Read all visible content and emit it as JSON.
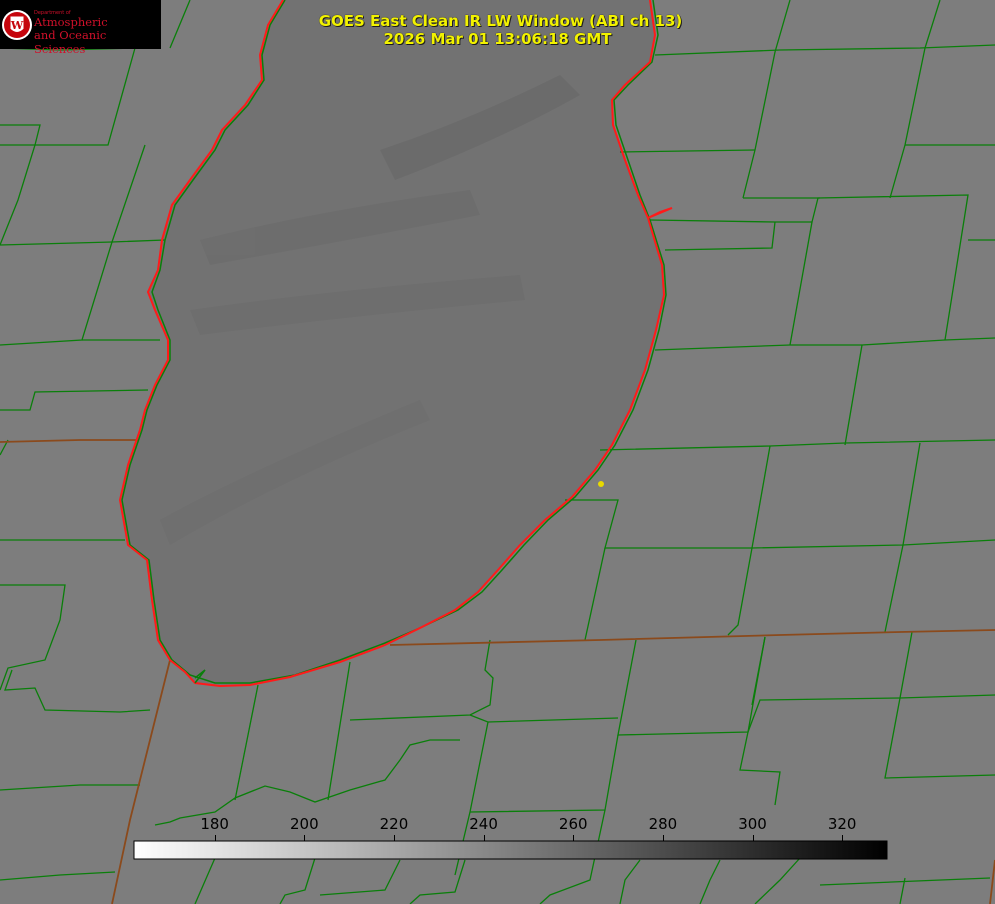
{
  "logo": {
    "department": "Department of",
    "line1": "Atmospheric",
    "line2": "and Oceanic Sciences",
    "seal_letter": "W"
  },
  "title": {
    "line1": "GOES East Clean IR LW Window (ABI ch 13)",
    "line2": "2026 Mar 01 13:06:18 GMT"
  },
  "colorbar": {
    "ticks": [
      "180",
      "200",
      "220",
      "240",
      "260",
      "280",
      "300",
      "320"
    ],
    "tick_values": [
      180,
      200,
      220,
      240,
      260,
      280,
      300,
      320
    ],
    "range": [
      162,
      330
    ],
    "colormap": "white-to-black (brightness temperature, K)"
  },
  "colors": {
    "land": "#7d7d7d",
    "lake": "#727272",
    "county_lines": "#0a7f0a",
    "state_lines": "#8b4a1c",
    "coastline": "#ff1a1a",
    "marker": "#e8d900",
    "title_text": "#f2f200"
  }
}
